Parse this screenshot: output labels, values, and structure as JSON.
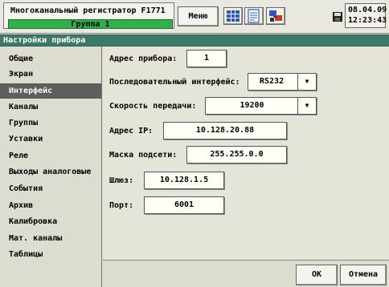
{
  "device": {
    "title": "Многоканальный регистратор F1771",
    "group": "Группа 1"
  },
  "toolbar": {
    "menu_label": "Меню",
    "icons": [
      "grid-icon",
      "document-icon",
      "network-icon",
      "disk-icon"
    ]
  },
  "clock": {
    "date": "08.04.09",
    "time": "12:23:43"
  },
  "header": {
    "title": "Настройки прибора"
  },
  "sidebar": {
    "items": [
      {
        "label": "Общие"
      },
      {
        "label": "Экран"
      },
      {
        "label": "Интерфейс",
        "active": true
      },
      {
        "label": "Каналы"
      },
      {
        "label": "Группы"
      },
      {
        "label": "Уставки"
      },
      {
        "label": "Реле"
      },
      {
        "label": "Выходы аналоговые"
      },
      {
        "label": "События"
      },
      {
        "label": "Архив"
      },
      {
        "label": "Калибровка"
      },
      {
        "label": "Мат. каналы"
      },
      {
        "label": "Таблицы"
      }
    ]
  },
  "form": {
    "device_address": {
      "label": "Адрес прибора:",
      "value": "1"
    },
    "serial_interface": {
      "label": "Последовательный интерфейс:",
      "value": "RS232"
    },
    "baud_rate": {
      "label": "Скорость передачи:",
      "value": "19200"
    },
    "ip_address": {
      "label": "Адрес IP:",
      "value": "10.128.20.88"
    },
    "subnet_mask": {
      "label": "Маска подсети:",
      "value": "255.255.0.0"
    },
    "gateway": {
      "label": "Шлюз:",
      "value": "10.128.1.5"
    },
    "port": {
      "label": "Порт:",
      "value": "6001"
    }
  },
  "buttons": {
    "ok": "ОК",
    "cancel": "Отмена"
  },
  "colors": {
    "group_bar": "#2fb04a",
    "header": "#3a7a66",
    "active_item": "#5e5e5e"
  }
}
